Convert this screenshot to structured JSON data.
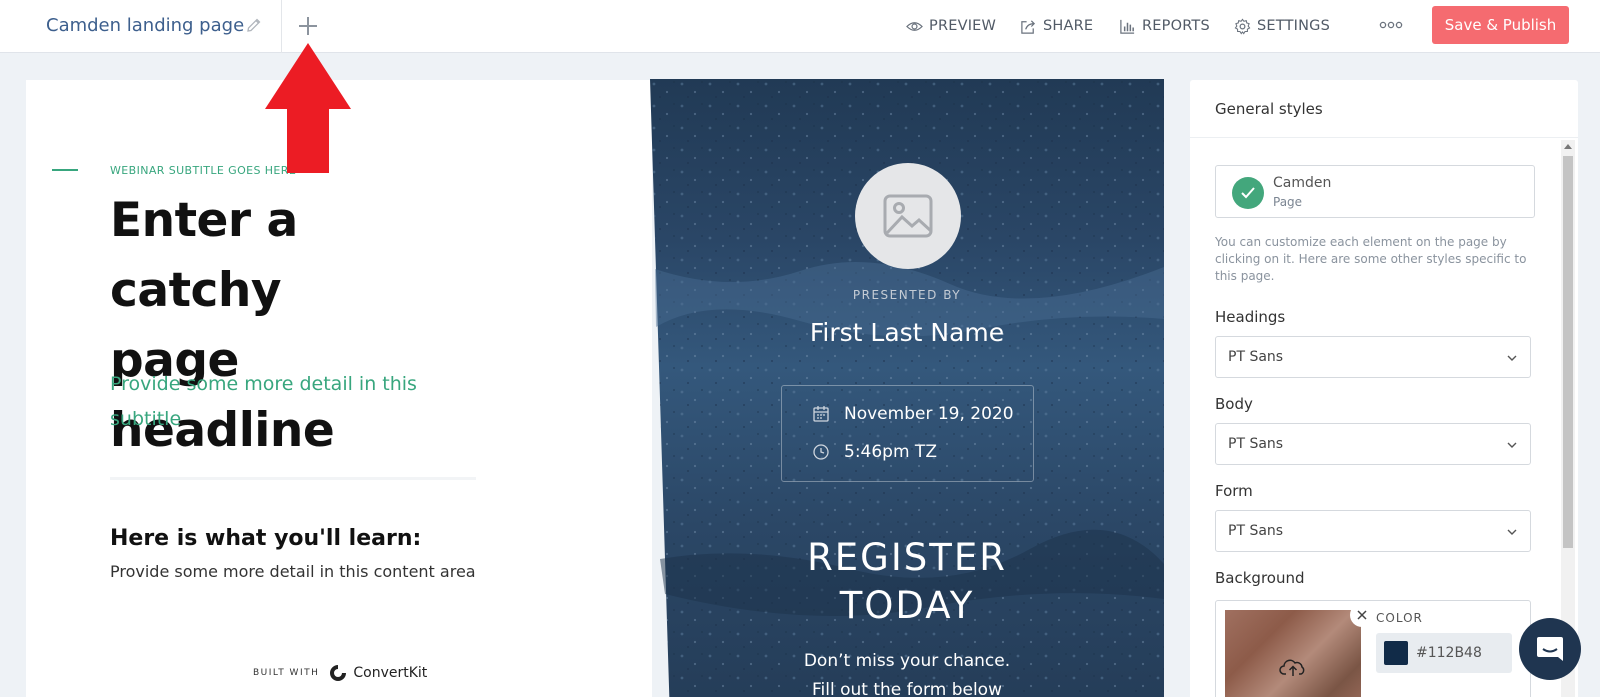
{
  "topbar": {
    "page_name": "Camden landing page",
    "nav": {
      "preview": "PREVIEW",
      "share": "SHARE",
      "reports": "REPORTS",
      "settings": "SETTINGS"
    },
    "publish_label": "Save & Publish",
    "publish_color": "#f56b70"
  },
  "page": {
    "subtitle_small": "WEBINAR SUBTITLE GOES HERE",
    "headline_line1": "Enter a catchy",
    "headline_line2": "page headline",
    "lead_line1": "Provide some more detail in this",
    "lead_line2": "subtitle",
    "learn_title": "Here is what you'll learn:",
    "learn_body": "Provide some more detail in this content area",
    "built_with": "BUILT WITH",
    "brand": "ConvertKit",
    "accent_color": "#38a67e"
  },
  "hero": {
    "presented_by": "PRESENTED BY",
    "presenter": "First Last Name",
    "date": "November 19, 2020",
    "time": "5:46pm TZ",
    "register_line1": "REGISTER",
    "register_line2": "TODAY",
    "cta_line1": "Don’t miss your chance.",
    "cta_line2": "Fill out the form below"
  },
  "sidebar": {
    "title": "General styles",
    "theme_name": "Camden",
    "theme_type": "Page",
    "help_text": "You can customize each element on the page by clicking on it. Here are some other styles specific to this page.",
    "headings_label": "Headings",
    "headings_value": "PT Sans",
    "body_label": "Body",
    "body_value": "PT Sans",
    "form_label": "Form",
    "form_value": "PT Sans",
    "background_label": "Background",
    "color_label": "COLOR",
    "color_value": "#112B48"
  },
  "icons": [
    "pencil-icon",
    "plus-icon",
    "eye-icon",
    "share-icon",
    "bar-chart-icon",
    "gear-icon",
    "more-icon",
    "image-placeholder-icon",
    "calendar-icon",
    "clock-icon",
    "check-icon",
    "chevron-down-icon",
    "close-icon",
    "upload-cloud-icon",
    "chat-icon",
    "convertkit-logo-icon"
  ]
}
